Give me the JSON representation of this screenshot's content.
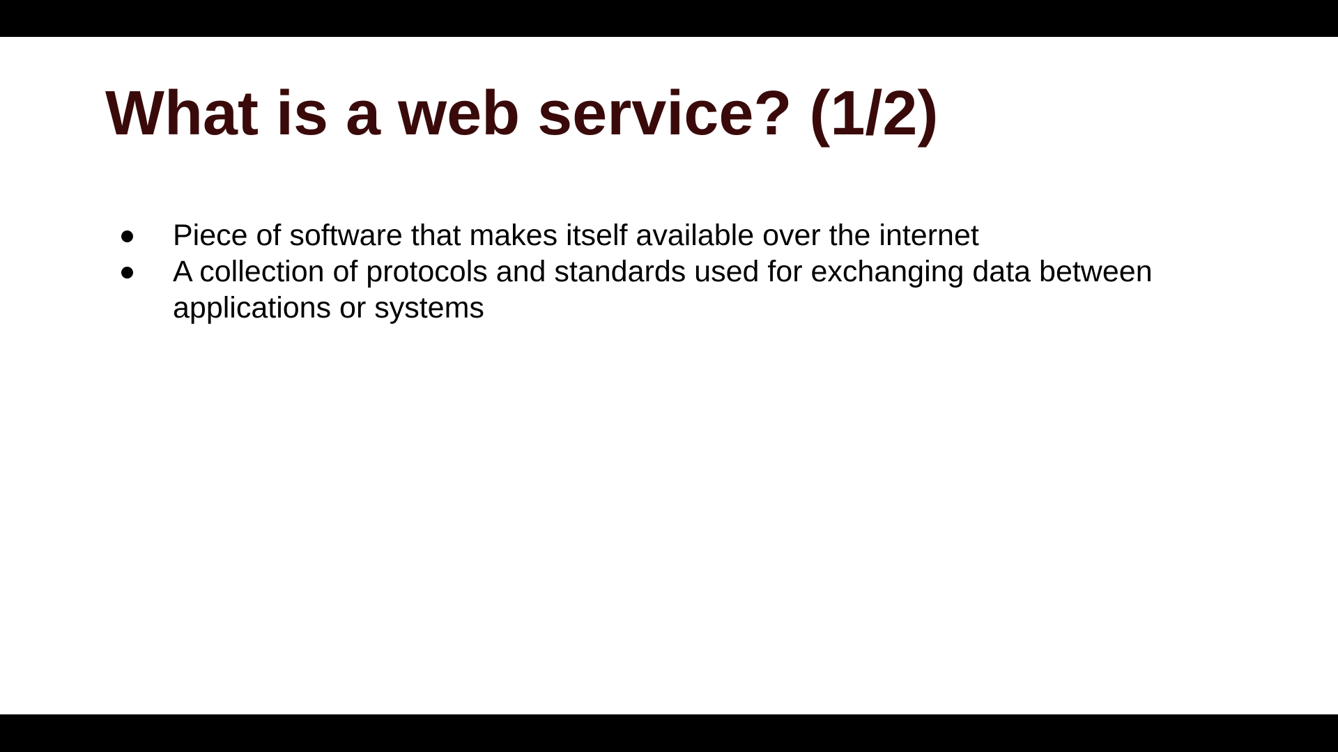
{
  "slide": {
    "title": "What is a web service? (1/2)",
    "title_color": "#3a0a0a",
    "bullets": [
      {
        "text": "Piece of software that makes itself available over the internet"
      },
      {
        "text": "A collection of protocols and standards used for exchanging data between applications or systems"
      }
    ]
  }
}
